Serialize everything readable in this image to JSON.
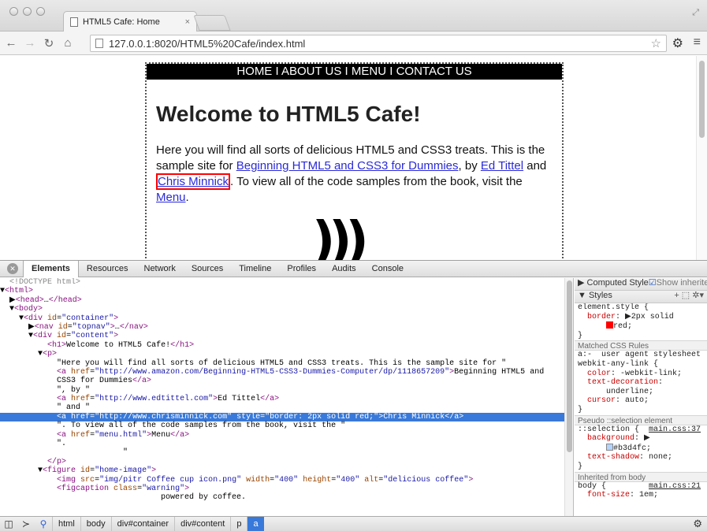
{
  "browser": {
    "tab_title": "HTML5 Cafe: Home",
    "tab_close": "×",
    "url": "127.0.0.1:8020/HTML5%20Cafe/index.html"
  },
  "page": {
    "nav": "HOME I ABOUT US I MENU I CONTACT US",
    "heading": "Welcome to HTML5 Cafe!",
    "para_1": "Here you will find all sorts of delicious HTML5 and CSS3 treats. This is the sample site for ",
    "link_book": "Beginning HTML5 and CSS3 for Dummies",
    "para_2": ", by ",
    "link_ed": "Ed Tittel",
    "para_3": " and ",
    "link_chris": "Chris Minnick",
    "para_4": ". To view all of the code samples from the book, visit the ",
    "link_menu": "Menu",
    "para_5": ".",
    "coffee_glyph": ")))"
  },
  "devtools": {
    "tabs": [
      "Elements",
      "Resources",
      "Network",
      "Sources",
      "Timeline",
      "Profiles",
      "Audits",
      "Console"
    ],
    "dom_lines": [
      "  <!DOCTYPE html>",
      "▼<html>",
      "  ▶<head>…</head>",
      "  ▼<body>",
      "    ▼<div id=\"container\">",
      "      ▶<nav id=\"topnav\">…</nav>",
      "      ▼<div id=\"content\">",
      "          <h1>Welcome to HTML5 Cafe!</h1>",
      "        ▼<p>",
      "            \"Here you will find all sorts of delicious HTML5 and CSS3 treats. This is the sample site for \"",
      "            <a href=\"http://www.amazon.com/Beginning-HTML5-CSS3-Dummies-Computer/dp/1118657209\">Beginning HTML5 and",
      "            CSS3 for Dummies</a>",
      "            \", by \"",
      "            <a href=\"http://www.edtittel.com\">Ed Tittel</a>",
      "            \" and \"",
      "            <a href=\"http://www.chrisminnick.com\" style=\"border: 2px solid red;\">Chris Minnick</a>",
      "            \". To view all of the code samples from the book, visit the \"",
      "            <a href=\"menu.html\">Menu</a>",
      "            \".",
      "                          \"",
      "          </p>",
      "        ▼<figure id=\"home-image\">",
      "            <img src=\"img/pitr Coffee cup icon.png\" width=\"400\" height=\"400\" alt=\"delicious coffee\">",
      "            <figcaption class=\"warning\">",
      "                                  powered by coffee."
    ],
    "selected_line": 15,
    "sidebar": {
      "computed": "▶ Computed Style",
      "show_inherited": "Show inherited",
      "styles": "▼ Styles",
      "styles_tools": "+ ⬚ ✲▾",
      "element_style": [
        "element.style {",
        "  border: ▶2px solid",
        "      red;",
        "}"
      ],
      "matched_header": "Matched CSS Rules",
      "matched_rules": [
        "a:-  user agent stylesheet",
        "webkit-any-link {",
        "  color: -webkit-link;",
        "  text-decoration:",
        "      underline;",
        "  cursor: auto;",
        "}"
      ],
      "pseudo_header": "Pseudo ::selection element",
      "pseudo_rules": [
        "::selection {  main.css:37",
        "  background: ▶",
        "      #b3d4fc;",
        "  text-shadow: none;",
        "}"
      ],
      "inherited_header": "Inherited from body",
      "inherited_rules": [
        "body {         main.css:21",
        "  font-size: 1em;"
      ]
    },
    "breadcrumbs": [
      "html",
      "body",
      "div#container",
      "div#content",
      "p",
      "a"
    ],
    "colors": {
      "red": "#ff0000",
      "selection_bg": "#b3d4fc"
    }
  }
}
